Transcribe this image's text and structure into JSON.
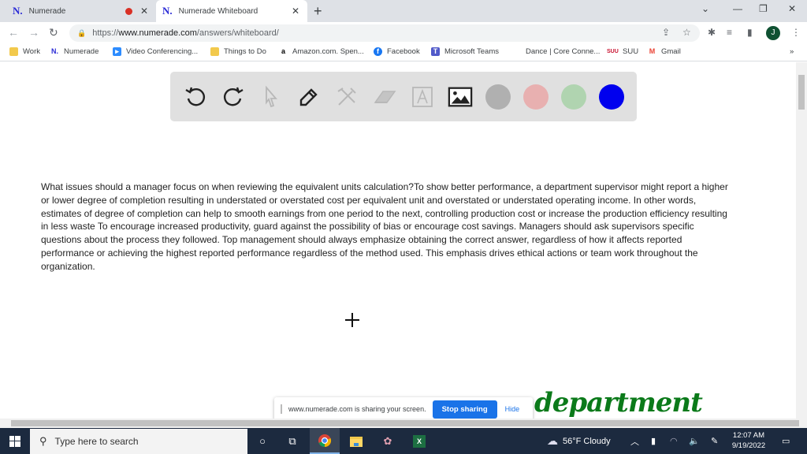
{
  "browser": {
    "tabs": [
      {
        "label": "Numerade",
        "favicon": "N.",
        "recording": true,
        "active": false
      },
      {
        "label": "Numerade Whiteboard",
        "favicon": "N.",
        "recording": false,
        "active": true
      }
    ],
    "new_tab": "+",
    "window_controls": {
      "tab_search": "⌄",
      "minimize": "—",
      "restore": "❐",
      "close": "✕"
    },
    "nav": {
      "back": "←",
      "forward": "→",
      "reload": "↻"
    },
    "url": {
      "scheme": "https://",
      "domain": "www.numerade.com",
      "path": "/answers/whiteboard/"
    },
    "profile_initial": "J",
    "bookmarks": [
      {
        "label": "Work",
        "icon": "folder-icon"
      },
      {
        "label": "Numerade",
        "icon": "numerade-icon"
      },
      {
        "label": "Video Conferencing...",
        "icon": "zoom-icon"
      },
      {
        "label": "Things to Do",
        "icon": "folder-icon"
      },
      {
        "label": "Amazon.com. Spen...",
        "icon": "amazon-icon"
      },
      {
        "label": "Facebook",
        "icon": "facebook-icon"
      },
      {
        "label": "Microsoft Teams",
        "icon": "teams-icon"
      },
      {
        "label": "Dance | Core Conne...",
        "icon": "none"
      },
      {
        "label": "SUU",
        "icon": "suu-icon"
      },
      {
        "label": "Gmail",
        "icon": "gmail-icon"
      }
    ],
    "bookmarks_overflow": "»"
  },
  "whiteboard": {
    "tools": [
      "undo",
      "redo",
      "select",
      "pen",
      "tools",
      "eraser",
      "text",
      "image"
    ],
    "colors": [
      "#b0b0b0",
      "#e8b0b0",
      "#b0d4b0",
      "#0000ee"
    ],
    "answer_text": "What issues should a manager focus on when reviewing the equivalent units calculation?To show better performance, a department supervisor might report a higher or lower degree of completion resulting in understated or overstated cost per equivalent unit and overstated or understated operating income. In other words, estimates of degree of completion can help to smooth earnings from one period to the next, controlling production cost or increase the production efficiency resulting in less waste To encourage increased productivity, guard against the possibility of bias or encourage cost savings. Managers should ask supervisors specific questions about the process they followed. Top management should always emphasize obtaining the correct answer, regardless of how it affects reported performance or achieving the highest reported performance regardless of the method used. This emphasis drives ethical actions or team work throughout the organization.",
    "handwriting": "department"
  },
  "share_bar": {
    "message": "www.numerade.com is sharing your screen.",
    "stop_label": "Stop sharing",
    "hide_label": "Hide"
  },
  "taskbar": {
    "search_placeholder": "Type here to search",
    "weather": "56°F  Cloudy",
    "time": "12:07 AM",
    "date": "9/19/2022"
  }
}
